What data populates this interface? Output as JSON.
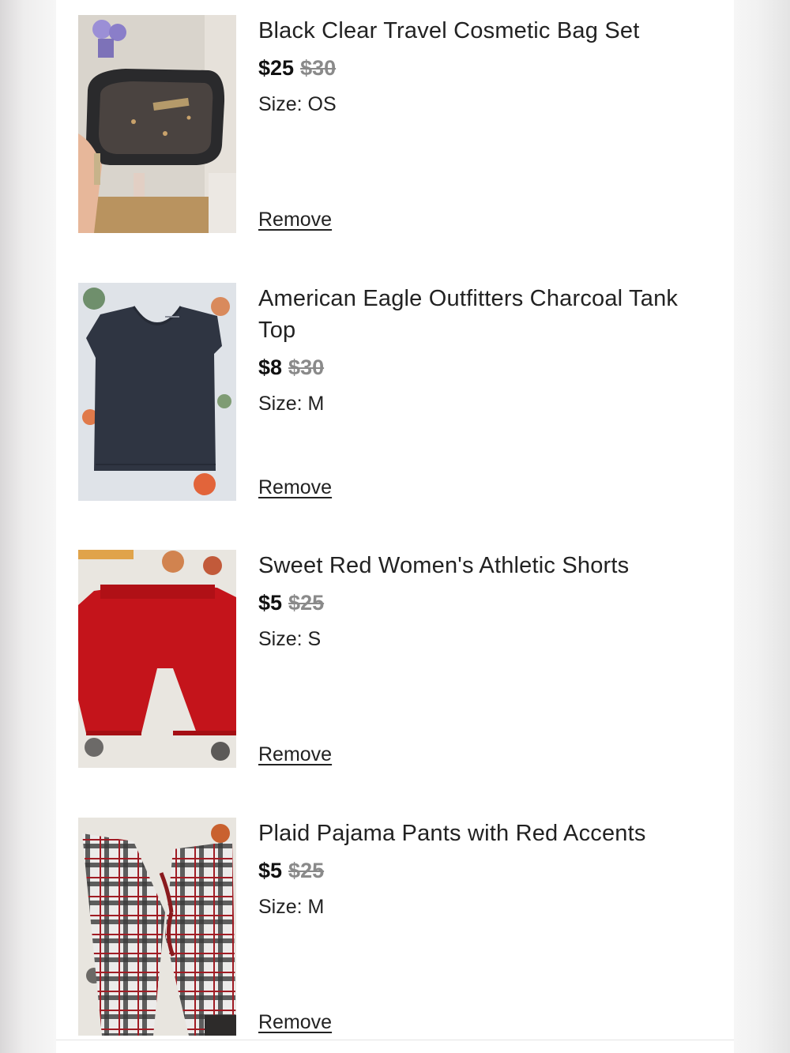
{
  "cart": {
    "remove_label": "Remove",
    "items": [
      {
        "title": "Black Clear Travel Cosmetic Bag Set",
        "price": "$25",
        "original_price": "$30",
        "size_label": "Size: OS",
        "image": "cosmetic-bag-photo"
      },
      {
        "title": "American Eagle Outfitters Charcoal Tank Top",
        "price": "$8",
        "original_price": "$30",
        "size_label": "Size: M",
        "image": "tank-top-photo"
      },
      {
        "title": "Sweet Red Women's Athletic Shorts",
        "price": "$5",
        "original_price": "$25",
        "size_label": "Size: S",
        "image": "red-shorts-photo"
      },
      {
        "title": "Plaid Pajama Pants with Red Accents",
        "price": "$5",
        "original_price": "$25",
        "size_label": "Size: M",
        "image": "plaid-pants-photo"
      }
    ]
  },
  "colors": {
    "text": "#222222",
    "strike_price": "#8a8a8a",
    "page_bg": "#ffffff"
  }
}
